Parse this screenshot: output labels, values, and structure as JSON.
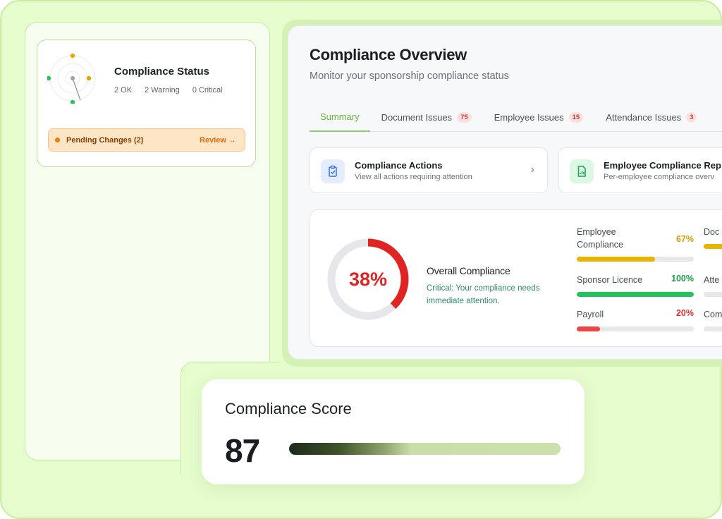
{
  "status_card": {
    "title": "Compliance Status",
    "ok": "2 OK",
    "warning": "2 Warning",
    "critical": "0 Critical",
    "pending_label": "Pending Changes (2)",
    "review_label": "Review →"
  },
  "overview": {
    "title": "Compliance Overview",
    "subtitle": "Monitor your sponsorship compliance status",
    "tabs": [
      {
        "label": "Summary",
        "badge": ""
      },
      {
        "label": "Document Issues",
        "badge": "75"
      },
      {
        "label": "Employee Issues",
        "badge": "15"
      },
      {
        "label": "Attendance Issues",
        "badge": "3"
      }
    ],
    "actions": [
      {
        "title": "Compliance Actions",
        "sub": "View all actions requiring attention",
        "icon": "clipboard-check-icon"
      },
      {
        "title": "Employee Compliance Rep",
        "sub": "Per-employee compliance overv",
        "icon": "report-chart-icon"
      }
    ],
    "overall": {
      "percent_label": "38%",
      "percent": 38,
      "title": "Overall Compliance",
      "note": "Critical: Your compliance needs immediate attention."
    },
    "metrics": [
      {
        "label": "Employee Compliance",
        "pct_label": "67%",
        "pct": 67,
        "color": "#e7b400",
        "text_color": "#d39c00"
      },
      {
        "label": "Sponsor Licence",
        "pct_label": "100%",
        "pct": 100,
        "color": "#22c35a",
        "text_color": "#1a9d4a"
      },
      {
        "label": "Payroll",
        "pct_label": "20%",
        "pct": 20,
        "color": "#ef4444",
        "text_color": "#dc3030"
      }
    ],
    "metrics_cut": [
      "Doc",
      "Atte",
      "Com"
    ]
  },
  "score_card": {
    "title": "Compliance Score",
    "value": "87"
  },
  "colors": {
    "accent_green": "#8fd062",
    "ring_red": "#e02424",
    "ring_track": "#e6e7ea"
  }
}
